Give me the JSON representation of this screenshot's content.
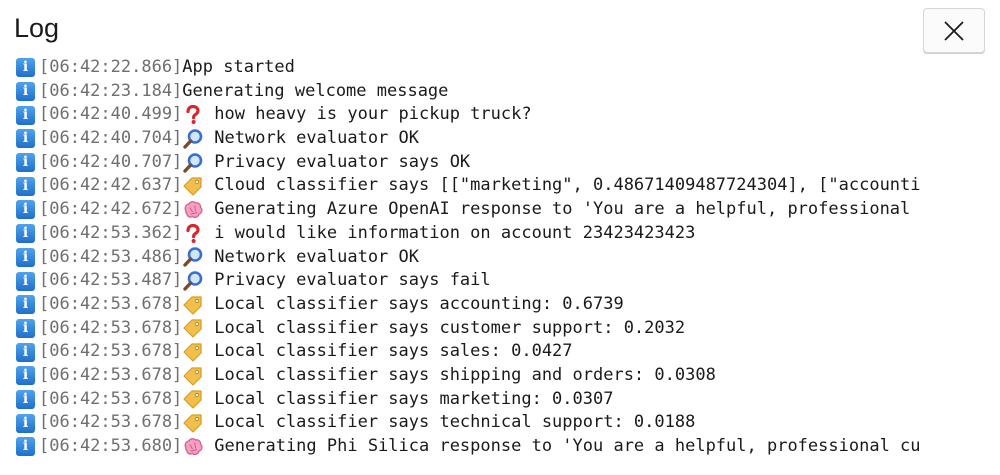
{
  "window": {
    "title": "Log"
  },
  "icons": {
    "close": "close-icon",
    "info": "info-icon",
    "question": "red-question-mark-icon",
    "search": "magnifying-glass-icon",
    "tag": "label-tag-icon",
    "brain": "brain-icon"
  },
  "colors": {
    "info_badge": "#2f84dd",
    "timestamp": "#6f6f6f",
    "question": "#d8262e",
    "search": "#3a6fd0",
    "tag": "#f2c04a",
    "brain": "#ef6fa3"
  },
  "log": [
    {
      "ts": "[06:42:22.866]",
      "icon": "none",
      "text": "App started"
    },
    {
      "ts": "[06:42:23.184]",
      "icon": "none",
      "text": "Generating welcome message"
    },
    {
      "ts": "[06:42:40.499]",
      "icon": "question",
      "text": "how heavy is your pickup truck?"
    },
    {
      "ts": "[06:42:40.704]",
      "icon": "search",
      "text": "Network evaluator OK"
    },
    {
      "ts": "[06:42:40.707]",
      "icon": "search",
      "text": "Privacy evaluator says OK"
    },
    {
      "ts": "[06:42:42.637]",
      "icon": "tag",
      "text": "Cloud classifier says [[\"marketing\", 0.48671409487724304], [\"accounti"
    },
    {
      "ts": "[06:42:42.672]",
      "icon": "brain",
      "text": "Generating Azure OpenAI response to 'You are a helpful, professional"
    },
    {
      "ts": "[06:42:53.362]",
      "icon": "question",
      "text": "i would like information on account 23423423423"
    },
    {
      "ts": "[06:42:53.486]",
      "icon": "search",
      "text": "Network evaluator OK"
    },
    {
      "ts": "[06:42:53.487]",
      "icon": "search",
      "text": "Privacy evaluator says fail"
    },
    {
      "ts": "[06:42:53.678]",
      "icon": "tag",
      "text": "Local classifier says accounting: 0.6739"
    },
    {
      "ts": "[06:42:53.678]",
      "icon": "tag",
      "text": "Local classifier says customer support: 0.2032"
    },
    {
      "ts": "[06:42:53.678]",
      "icon": "tag",
      "text": "Local classifier says sales: 0.0427"
    },
    {
      "ts": "[06:42:53.678]",
      "icon": "tag",
      "text": "Local classifier says shipping and orders: 0.0308"
    },
    {
      "ts": "[06:42:53.678]",
      "icon": "tag",
      "text": "Local classifier says marketing: 0.0307"
    },
    {
      "ts": "[06:42:53.678]",
      "icon": "tag",
      "text": "Local classifier says technical support: 0.0188"
    },
    {
      "ts": "[06:42:53.680]",
      "icon": "brain",
      "text": "Generating Phi Silica response to 'You are a helpful, professional cu"
    }
  ]
}
